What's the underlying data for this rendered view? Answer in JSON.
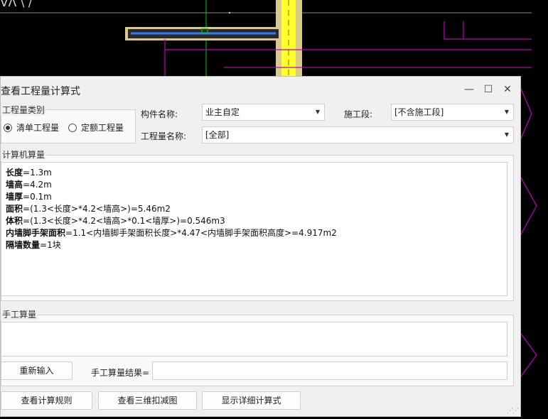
{
  "background": {
    "corner_label": "VΛ \\ /",
    "colors": {
      "canvas": "#000000",
      "magenta": "#c000c0",
      "yellow": "#ffff00",
      "blue": "#2f7bff"
    }
  },
  "dialog": {
    "title": "查看工程量计算式",
    "window_controls": {
      "minimize": "—",
      "maximize": "☐",
      "close": "✕"
    },
    "quantity_type": {
      "group_title": "工程量类别",
      "options": [
        {
          "label": "清单工程量",
          "selected": true
        },
        {
          "label": "定额工程量",
          "selected": false
        }
      ]
    },
    "component_name": {
      "label": "构件名称:",
      "value": "业主自定"
    },
    "construction_stage": {
      "label": "施工段:",
      "value": "[不含施工段]"
    },
    "quantity_name": {
      "label": "工程量名称:",
      "value": "[全部]"
    },
    "computer_calc": {
      "group_title": "计算机算量",
      "lines": [
        {
          "name": "长度",
          "expr": "=1.3m"
        },
        {
          "name": "墙高",
          "expr": "=4.2m"
        },
        {
          "name": "墙厚",
          "expr": "=0.1m"
        },
        {
          "name": "面积",
          "expr": "=(1.3<长度>*4.2<墙高>)=5.46m2"
        },
        {
          "name": "体积",
          "expr": "=(1.3<长度>*4.2<墙高>*0.1<墙厚>)=0.546m3"
        },
        {
          "name": "内墙脚手架面积",
          "expr": "=1.1<内墙脚手架面积长度>*4.47<内墙脚手架面积高度>=4.917m2"
        },
        {
          "name": "隔墙数量",
          "expr": "=1块"
        }
      ]
    },
    "manual_calc": {
      "group_title": "手工算量",
      "reenter_button": "重新输入",
      "result_label": "手工算量结果=",
      "result_value": ""
    },
    "footer_buttons": {
      "view_rules": "查看计算规则",
      "view_3d": "查看三维扣减图",
      "show_detail": "显示详细计算式"
    }
  }
}
